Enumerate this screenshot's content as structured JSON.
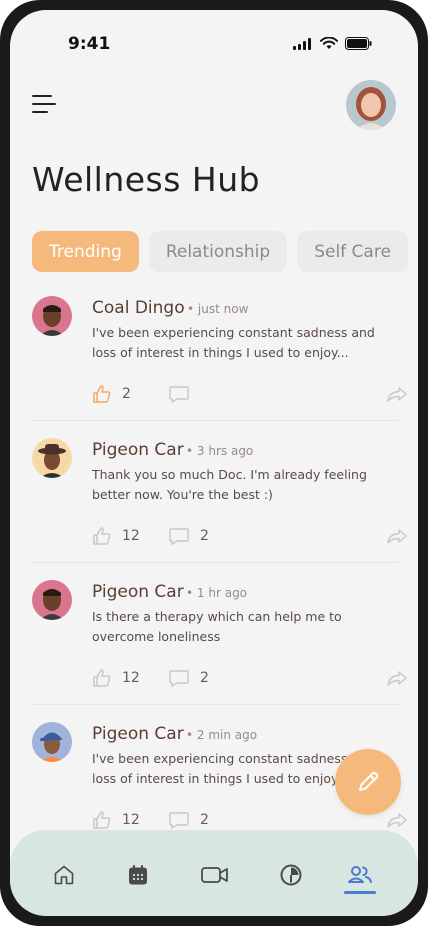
{
  "status_bar": {
    "time": "9:41"
  },
  "header": {
    "title": "Wellness Hub"
  },
  "tabs": [
    {
      "label": "Trending",
      "active": true
    },
    {
      "label": "Relationship",
      "active": false
    },
    {
      "label": "Self Care",
      "active": false
    }
  ],
  "posts": [
    {
      "author": "Coal Dingo",
      "time": "just now",
      "body": "I've been experiencing constant sadness and loss of interest in things I used to enjoy...",
      "likes": "2",
      "comments": "",
      "liked": true
    },
    {
      "author": "Pigeon Car",
      "time": "3 hrs ago",
      "body": "Thank you so much Doc. I'm already feeling better now. You're the best :)",
      "likes": "12",
      "comments": "2",
      "liked": false
    },
    {
      "author": "Pigeon Car",
      "time": "1 hr ago",
      "body": "Is there a therapy which can help me to overcome loneliness",
      "likes": "12",
      "comments": "2",
      "liked": false
    },
    {
      "author": "Pigeon Car",
      "time": "2 min ago",
      "body": "I've been experiencing constant sadness and loss of interest in things I used to enjoy...",
      "likes": "12",
      "comments": "2",
      "liked": false
    }
  ],
  "icons": {
    "menu": "hamburger-menu-icon",
    "fab": "pencil-icon",
    "like": "thumbs-up-icon",
    "comment": "comment-icon",
    "share": "share-icon",
    "nav": [
      "home-icon",
      "calendar-icon",
      "video-icon",
      "progress-icon",
      "community-icon"
    ]
  },
  "colors": {
    "accent": "#f5b97d",
    "nav_bg": "#d7e6e1",
    "nav_active": "#4a7bd0",
    "text_brown": "#5a3e34"
  },
  "nav": {
    "active_index": 4
  }
}
